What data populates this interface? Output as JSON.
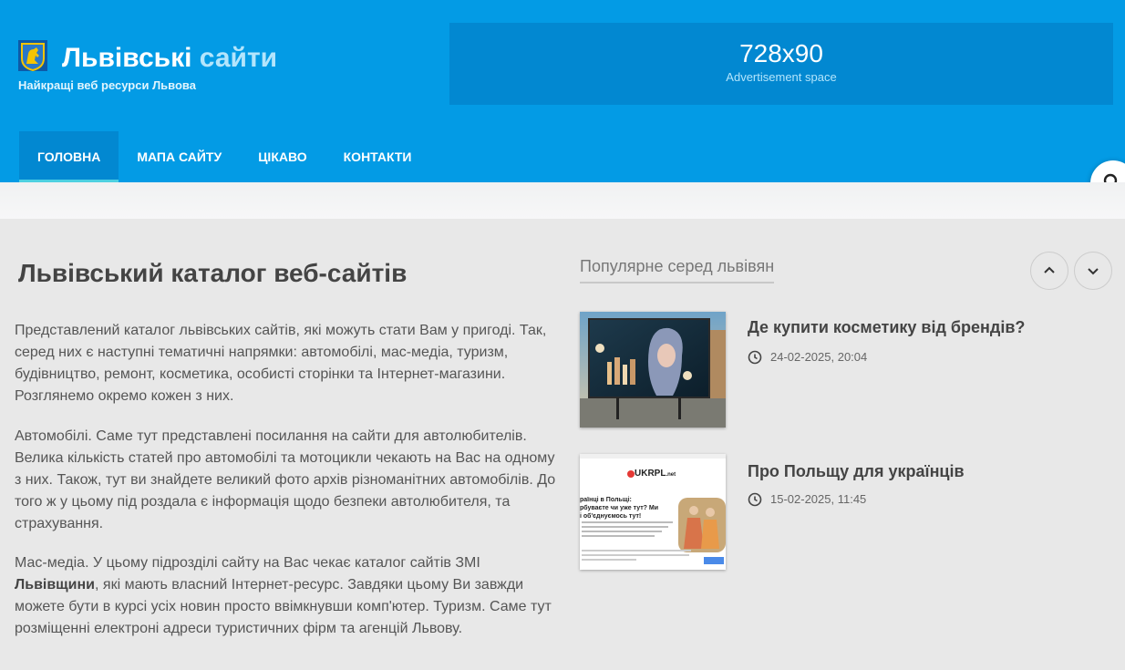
{
  "header": {
    "title_main": "Львівські",
    "title_accent": "сайти",
    "tagline": "Найкращі веб ресурси Львова",
    "ad_size": "728x90",
    "ad_text": "Advertisement space",
    "icon": "lion-crest-icon"
  },
  "nav": {
    "items": [
      "ГОЛОВНА",
      "МАПА САЙТУ",
      "ЦІКАВО",
      "КОНТАКТИ"
    ],
    "active": "ГОЛОВНА",
    "search_icon": "search-icon"
  },
  "main": {
    "title": "Львівський каталог веб-сайтів",
    "p1": "Представлений каталог львівських сайтів, які можуть стати Вам у пригоді. Так, серед них є наступні тематичні напрямки: автомобілі, мас-медіа, туризм, будівництво, ремонт, косметика, особисті сторінки та Інтернет-магазини. Розглянемо окремо кожен з них.",
    "p2": "Автомобілі. Саме тут представлені посилання на сайти для автолюбителів. Велика кількість статей про автомобілі та мотоцикли чекають на Вас на одному з них. Також, тут ви знайдете великий фото архів різноманітних автомобілів. До того ж у цьому під роздала є інформація щодо безпеки автолюбителя, та страхування.",
    "p3_before": "Мас-медіа. У цьому підрозділі сайту на Вас чекає каталог сайтів ЗМІ ",
    "p3_bold": "Львівщини",
    "p3_after": ", які мають власний Інтернет-ресурс. Завдяки цьому Ви завжди можете бути в курсі усіх новин просто ввімкнувши комп'ютер. Туризм. Саме тут розміщенні електроні адреси туристичних фірм та агенцій Львову."
  },
  "sidebar": {
    "title": "Популярне серед львівян",
    "posts": [
      {
        "title": "Де купити косметику від брендів?",
        "date": "24-02-2025, 20:04"
      },
      {
        "title": "Про Польщу для українців",
        "date": "15-02-2025, 11:45"
      }
    ],
    "thumb2": {
      "logo": "UKRPL",
      "logo_suffix": ".net",
      "heading_l1": "раїнці в Польщі:",
      "heading_l2": "рбуваєте чи уже тут? Ми",
      "heading_l3": "і об'єднуємось тут!"
    }
  },
  "colors": {
    "brand": "#039be5",
    "brand_dark": "#0288d1",
    "accent": "#b3e5fc"
  }
}
